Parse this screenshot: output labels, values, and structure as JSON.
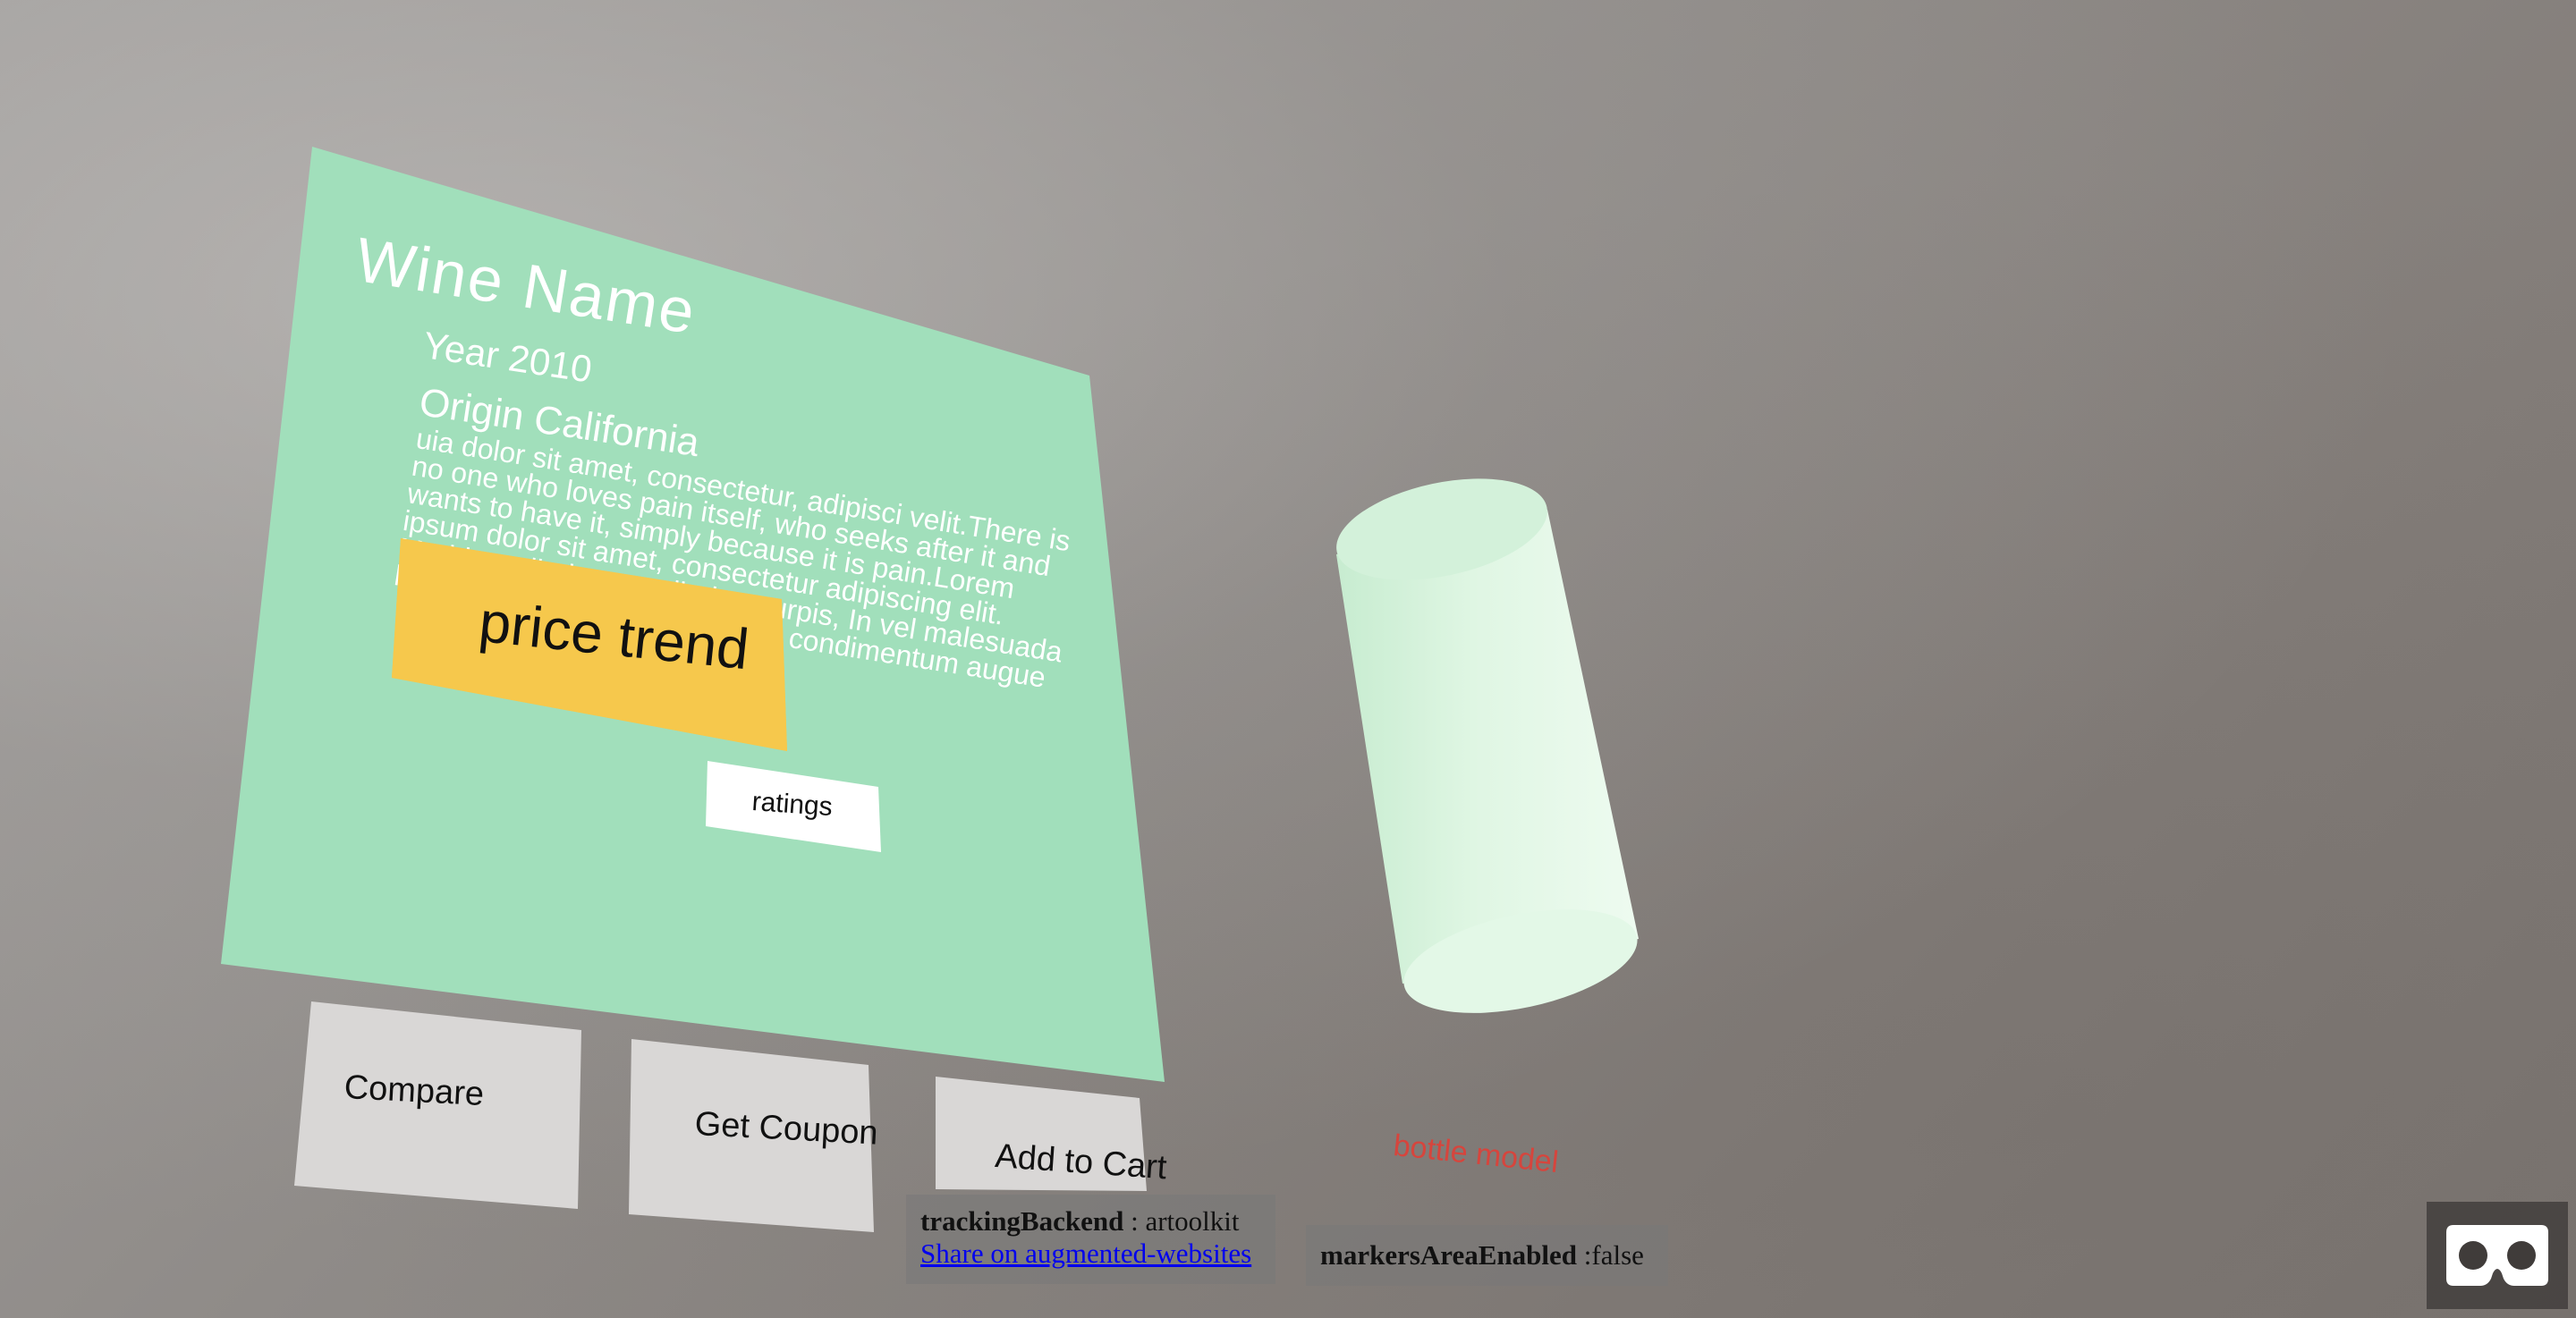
{
  "panel": {
    "title": "Wine Name",
    "year": "Year 2010",
    "origin": "Origin California",
    "description": "uia dolor sit amet, consectetur, adipisci velit.There is no one who loves pain itself, who seeks after it and wants to have it, simply because it is pain.Lorem ipsum dolor sit amet, consectetur adipiscing elit. Morbi vestibulum vestibulum turpis, In vel malesuada lorem. Proin hendrerit libero ac condimentum augue",
    "price_trend_label": "price trend",
    "ratings_label": "ratings",
    "panel_color": "#a1dfbb",
    "price_trend_color": "#f6c84c"
  },
  "actions": {
    "compare_label": "Compare",
    "get_coupon_label": "Get Coupon",
    "add_to_cart_label": "Add to Cart"
  },
  "scene": {
    "bottle_label": "bottle model",
    "bottle_color": "#e6f7e9",
    "bottle_label_color": "#d6453d"
  },
  "debug": {
    "tracking_backend_key": "trackingBackend",
    "tracking_backend_value": " : artoolkit",
    "share_link_label": "Share on augmented-websites",
    "markers_area_key": "markersAreaEnabled",
    "markers_area_value": " :false"
  },
  "icons": {
    "vr": "vr-goggles-icon"
  }
}
